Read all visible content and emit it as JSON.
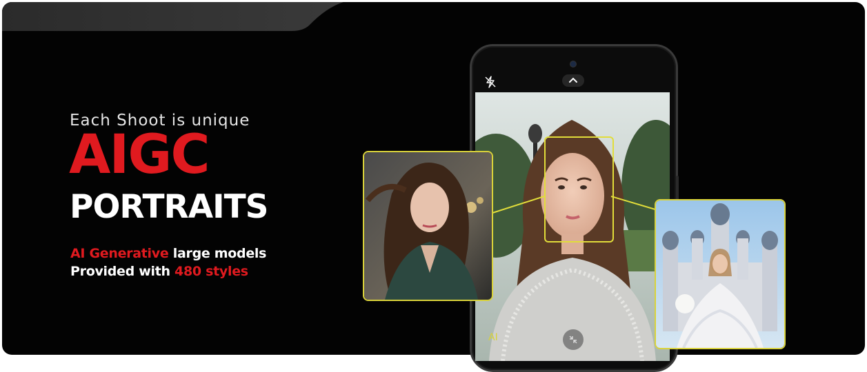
{
  "hero": {
    "tagline": "Each Shoot is unique",
    "headline": "AIGC",
    "subheadline": "PORTRAITS",
    "line1_highlight": "AI Generative",
    "line1_rest": " large models",
    "line2_start": "Provided with ",
    "line2_highlight": "480 styles"
  },
  "camera": {
    "mode_label": "AI"
  },
  "colors": {
    "accent_red": "#e01a1f",
    "frame_yellow": "#e1dd3a",
    "background": "#030303"
  },
  "icons": {
    "flash": "flash-off-icon",
    "chevron": "chevron-up-icon",
    "shrink": "shrink-icon"
  }
}
